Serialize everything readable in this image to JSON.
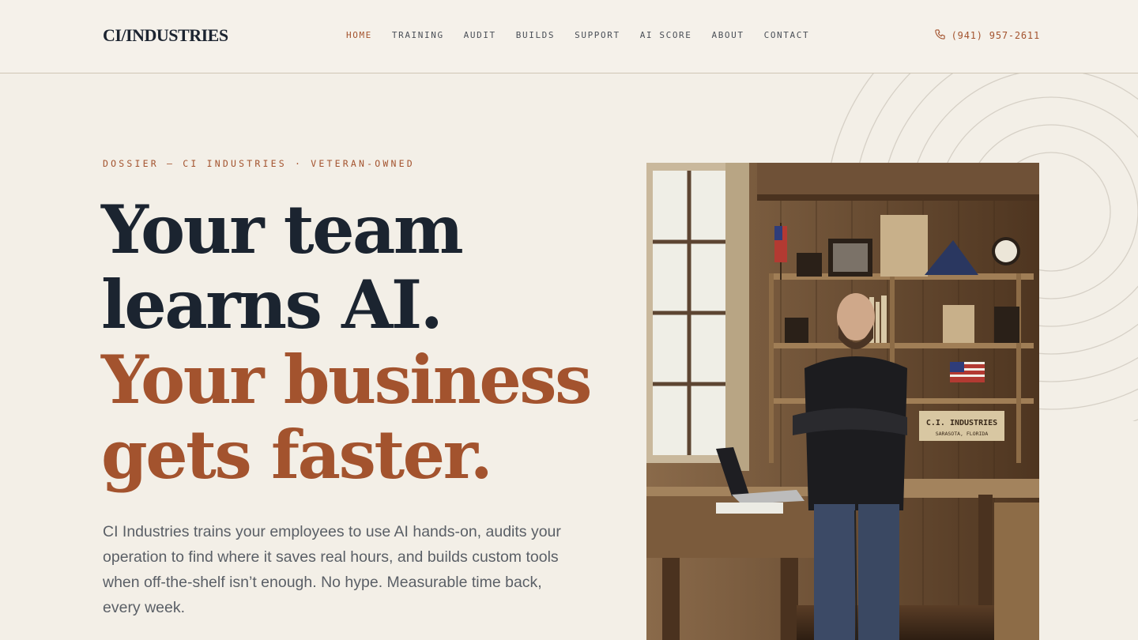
{
  "header": {
    "logo": "CI/INDUSTRIES",
    "nav": [
      {
        "label": "HOME",
        "active": true
      },
      {
        "label": "TRAINING",
        "active": false
      },
      {
        "label": "AUDIT",
        "active": false
      },
      {
        "label": "BUILDS",
        "active": false
      },
      {
        "label": "SUPPORT",
        "active": false
      },
      {
        "label": "AI SCORE",
        "active": false
      },
      {
        "label": "ABOUT",
        "active": false
      },
      {
        "label": "CONTACT",
        "active": false
      }
    ],
    "phone": "(941) 957-2611",
    "phone_icon": "phone-icon"
  },
  "hero": {
    "eyebrow": "DOSSIER — CI INDUSTRIES · VETERAN-OWNED",
    "headline": [
      "Your team",
      "learns AI.",
      "Your business",
      "gets faster."
    ],
    "lede": "CI Industries trains your employees to use AI hands-on, audits your operation to find where it saves real hours, and builds custom tools when off-the-shelf isn’t enough. No hype. Measurable time back, every week.",
    "photo": {
      "sign_line1": "C.I. INDUSTRIES",
      "sign_line2": "SARASOTA, FLORIDA"
    }
  },
  "colors": {
    "background": "#f3efe7",
    "accent": "#a3532e",
    "ink": "#1b2430"
  }
}
